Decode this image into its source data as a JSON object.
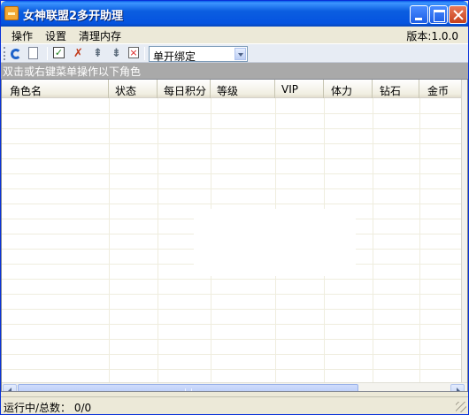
{
  "window": {
    "title": "女神联盟2多开助理",
    "icon": "app-icon",
    "title_bar_color": "#0a5ee8"
  },
  "menu": {
    "items": [
      "操作",
      "设置",
      "清理内存"
    ],
    "version": "版本:1.0.0"
  },
  "toolbar": {
    "icons": [
      "refresh-icon",
      "new-document-icon",
      "check-all-icon",
      "uncheck-icon",
      "move-up-icon",
      "move-down-icon",
      "delete-icon"
    ],
    "mode_select": {
      "value": "单开绑定"
    }
  },
  "hint": "双击或右键菜单操作以下角色",
  "table": {
    "columns": [
      "角色名",
      "状态",
      "每日积分",
      "等级",
      "VIP",
      "体力",
      "钻石",
      "金币"
    ],
    "rows": []
  },
  "status": {
    "label": "运行中/总数：",
    "value": "0/0"
  },
  "colors": {
    "hint_bar": "#a9a9a9",
    "window_bg": "#ece9d8",
    "grid_line": "#efedde"
  }
}
